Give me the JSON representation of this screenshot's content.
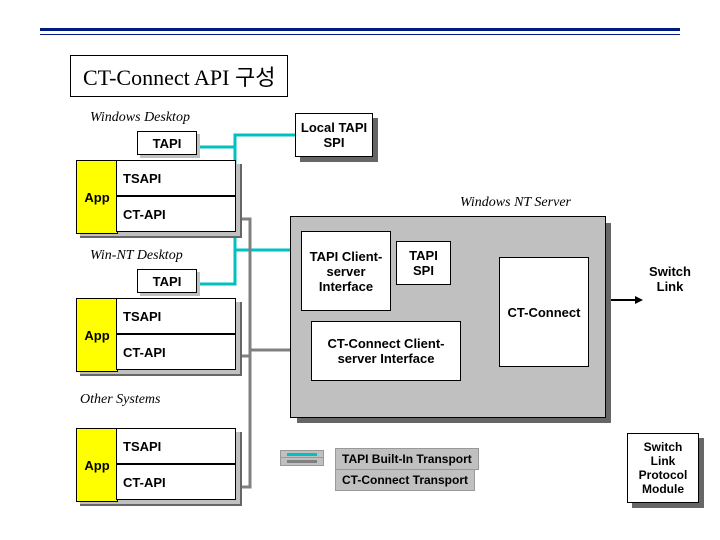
{
  "title": "CT-Connect API 구성",
  "labels": {
    "windows_desktop": "Windows Desktop",
    "winnt_desktop": "Win-NT Desktop",
    "other_systems": "Other Systems",
    "winnt_server": "Windows NT Server"
  },
  "boxes": {
    "app": "App",
    "tsapi": "TSAPI",
    "ctapi": "CT-API",
    "tapi": "TAPI",
    "local_tapi_spi": "Local TAPI SPI",
    "tapi_cs_interface": "TAPI Client-server Interface",
    "tapi_spi": "TAPI SPI",
    "ct_connect": "CT-Connect",
    "ct_cs_interface": "CT-Connect Client-server Interface",
    "switch_link": "Switch Link",
    "switch_module": "Switch Link Protocol Module"
  },
  "legend": {
    "tapi_transport": "TAPI Built-In Transport",
    "ct_transport": "CT-Connect Transport",
    "color_tapi": "#00c0c0",
    "color_ct": "#808080"
  },
  "colors": {
    "rule": "#001a80",
    "app_bg": "#ffff00",
    "panel_bg": "#c0c0c0"
  }
}
